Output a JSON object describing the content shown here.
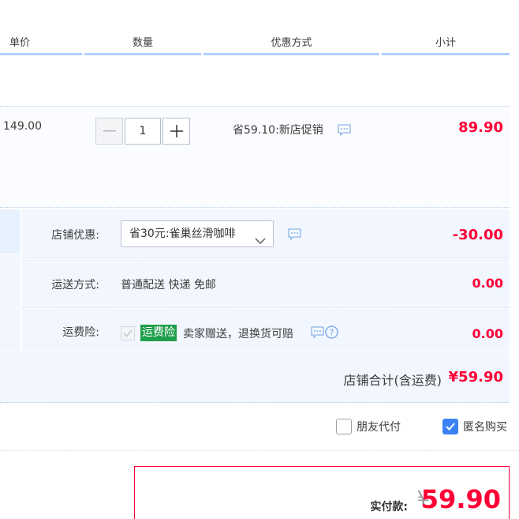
{
  "header": {
    "col_unit_price": "单价",
    "col_quantity": "数量",
    "col_promotion": "优惠方式",
    "col_subtotal": "小计"
  },
  "item": {
    "unit_price": "149.00",
    "quantity": "1",
    "decrease_symbol": "—",
    "increase_symbol": "+",
    "promotion": "省59.10:新店促销",
    "subtotal": "89.90"
  },
  "shop": {
    "discount_label": "店铺优惠:",
    "discount_selected": "省30元:雀巢丝滑咖啡",
    "discount_value": "-30.00",
    "shipping_label": "运送方式:",
    "shipping_value_text": "普通配送 快递 免邮",
    "shipping_value": "0.00",
    "insurance_label": "运费险:",
    "insurance_badge": "运费险",
    "insurance_text": "卖家赠送，退换货可赔",
    "insurance_value": "0.00",
    "total_label": "店铺合计(含运费)",
    "total_value": "¥59.90"
  },
  "options": {
    "friend_pay_label": "朋友代付",
    "friend_pay_checked": false,
    "anonymous_label": "匿名购买",
    "anonymous_checked": true
  },
  "payment": {
    "label": "实付款:",
    "currency": "¥",
    "amount": "59.90"
  },
  "colors": {
    "accent_red": "#ff0036",
    "header_underline": "#b2d1ff",
    "row_bg": "#f2f7ff",
    "insurance_green": "#1f9e4c",
    "checkbox_blue": "#3b82f6"
  }
}
